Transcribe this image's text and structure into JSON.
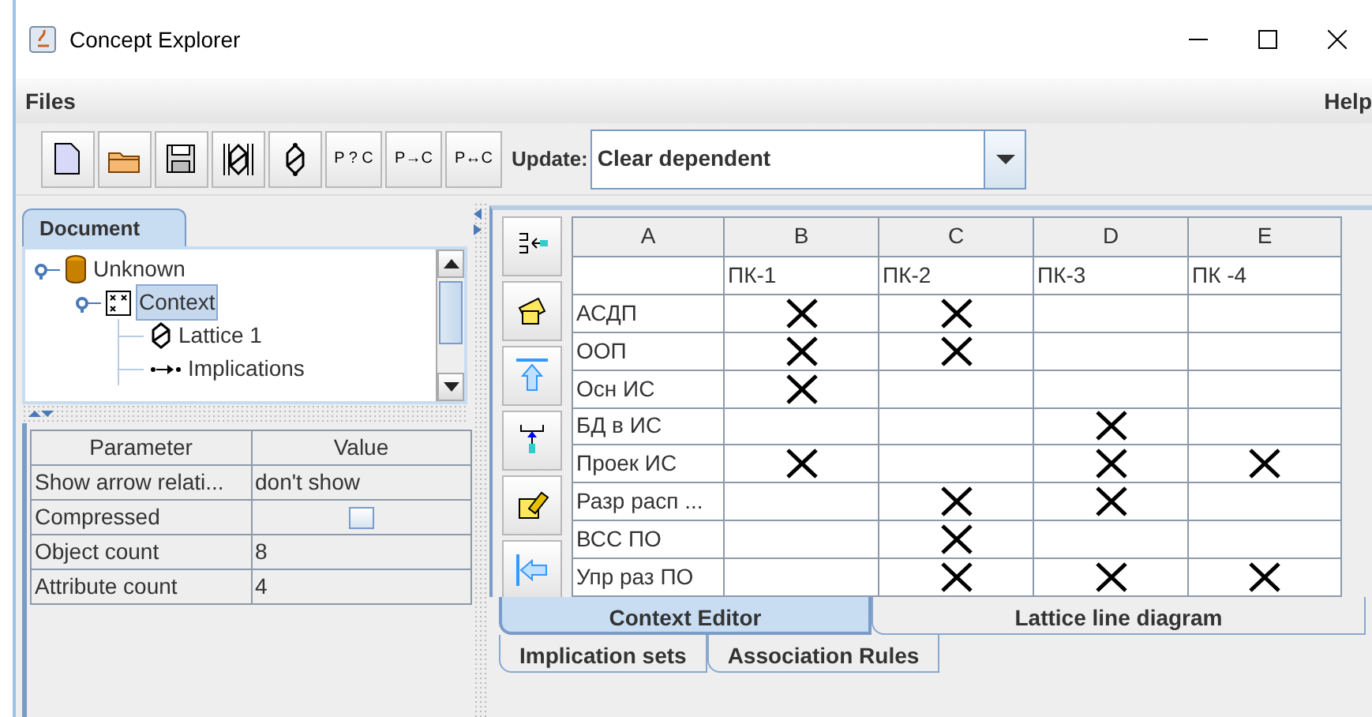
{
  "window": {
    "title": "Concept Explorer"
  },
  "menu": [
    {
      "label": "Files"
    },
    {
      "label": "Help"
    }
  ],
  "toolbar": {
    "buttons": [
      {
        "kind": "new"
      },
      {
        "kind": "open"
      },
      {
        "kind": "save"
      },
      {
        "kind": "lattice-framed"
      },
      {
        "kind": "lattice"
      },
      {
        "kind": "text",
        "label": "P ? C"
      },
      {
        "kind": "text",
        "label": "P→C"
      },
      {
        "kind": "text",
        "label": "P↔C"
      }
    ],
    "update_label": "Update:",
    "update_value": "Clear dependent"
  },
  "document_tab": {
    "label": "Document",
    "selected": true
  },
  "tree": [
    {
      "label": "Unknown",
      "kind": "database",
      "selected": false,
      "expanded": true,
      "children": [
        {
          "label": "Context",
          "kind": "context",
          "selected": true,
          "expanded": true,
          "children": [
            {
              "label": "Lattice 1",
              "kind": "lattice",
              "selected": false
            },
            {
              "label": "Implications",
              "kind": "implications",
              "selected": false
            }
          ]
        }
      ]
    }
  ],
  "parameters": {
    "columns": [
      "Parameter",
      "Value"
    ],
    "rows": [
      {
        "name": "Show arrow relati...",
        "kind": "text",
        "value": "don't show"
      },
      {
        "name": "Compressed",
        "kind": "checkbox",
        "checked": false
      },
      {
        "name": "Object count",
        "kind": "text",
        "value": "8"
      },
      {
        "name": "Attribute count",
        "kind": "text",
        "value": "4"
      }
    ]
  },
  "context": {
    "columns": [
      "A",
      "B",
      "C",
      "D",
      "E"
    ],
    "attributes": [
      "ПК-1",
      "ПК-2",
      "ПК-3",
      "ПК -4"
    ],
    "rows": [
      {
        "object": "АСДП",
        "cells": [
          true,
          true,
          false,
          false
        ]
      },
      {
        "object": "ООП",
        "cells": [
          true,
          true,
          false,
          false
        ]
      },
      {
        "object": "Осн ИС",
        "cells": [
          true,
          false,
          false,
          false
        ]
      },
      {
        "object": "БД в ИС",
        "cells": [
          false,
          false,
          true,
          false
        ]
      },
      {
        "object": "Проек ИС",
        "cells": [
          true,
          false,
          true,
          true
        ]
      },
      {
        "object": "Разр расп ...",
        "cells": [
          false,
          true,
          true,
          false
        ]
      },
      {
        "object": "ВСС ПО",
        "cells": [
          false,
          true,
          false,
          false
        ]
      },
      {
        "object": "Упр раз ПО",
        "cells": [
          false,
          true,
          true,
          true
        ]
      }
    ]
  },
  "view_tabs": [
    [
      {
        "label": "Context Editor",
        "selected": true
      },
      {
        "label": "Lattice line diagram",
        "selected": false
      }
    ],
    [
      {
        "label": "Implication sets",
        "selected": false
      },
      {
        "label": "Association Rules",
        "selected": false
      }
    ]
  ]
}
